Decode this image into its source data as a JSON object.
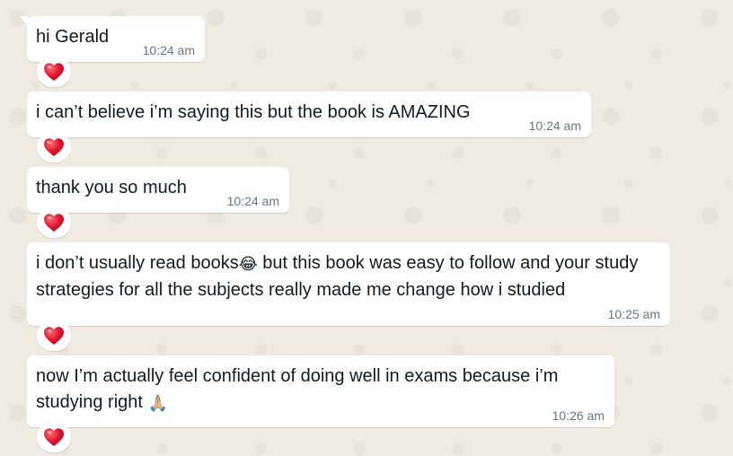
{
  "messages": [
    {
      "text": "hi Gerald",
      "time": "10:24 am",
      "reaction": "red-heart"
    },
    {
      "text": "i can’t believe i’m saying this but the book is AMAZING",
      "time": "10:24 am",
      "reaction": "red-heart"
    },
    {
      "text": "thank you so much",
      "time": "10:24 am",
      "reaction": "red-heart"
    },
    {
      "text_before_emoji": "i don’t usually read books",
      "emoji_1": "😂",
      "text_after_emoji": " but this book was easy to follow and your study strategies for all the subjects really made me change how i studied",
      "time": "10:25 am",
      "reaction": "red-heart"
    },
    {
      "text": "now I’m actually feel confident of doing well in exams because i’m studying right ",
      "emoji_1": "🙏🏼",
      "time": "10:26 am",
      "reaction": "red-heart"
    }
  ],
  "colors": {
    "background": "#efeae2",
    "bubble": "#ffffff",
    "text": "#111b21",
    "timestamp": "#667781",
    "heart": "#e0142d"
  }
}
